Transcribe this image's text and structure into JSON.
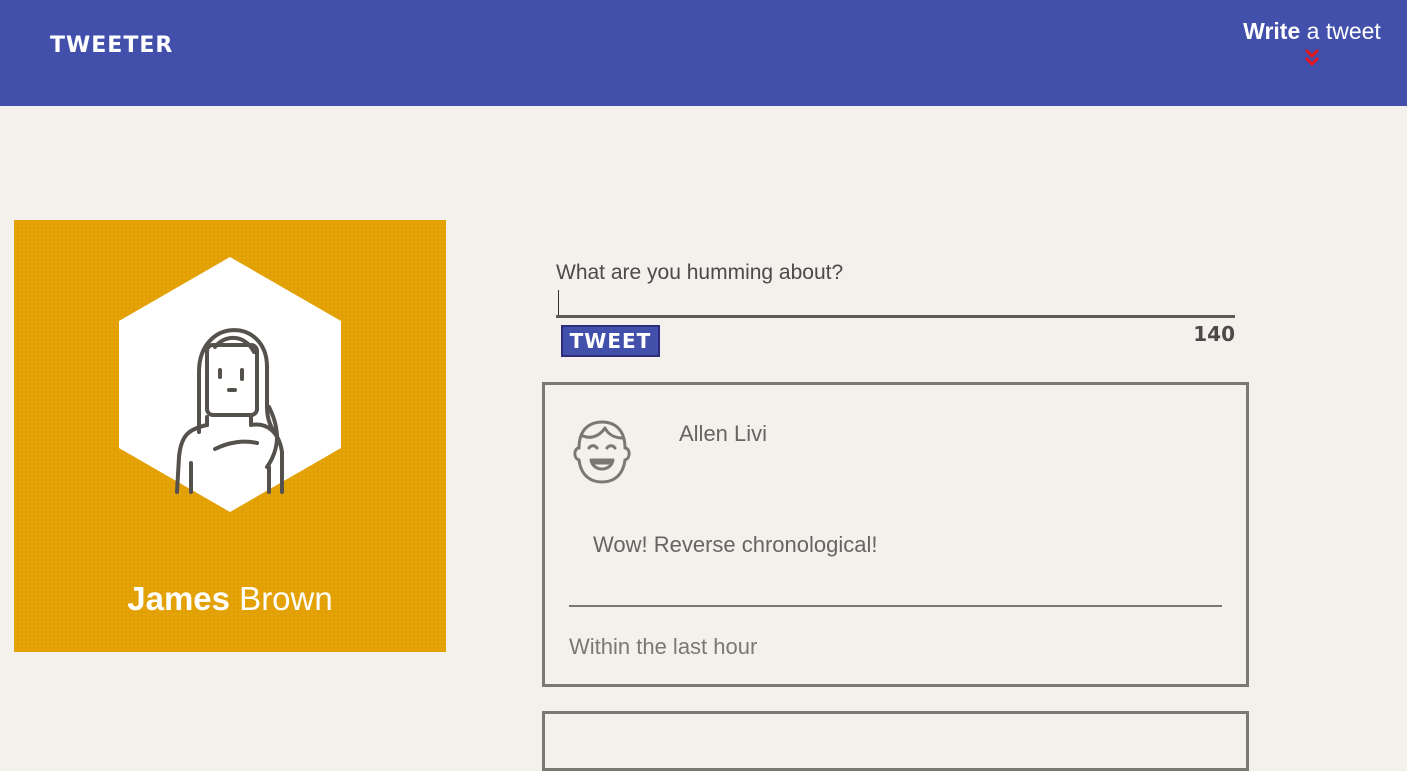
{
  "navbar": {
    "brand": "TWEETER",
    "compose": {
      "strong": "Write",
      "light": " a tweet",
      "arrow_icon": "double-chevron-down-icon",
      "arrow_color": "#e1151c"
    },
    "color": "#4350ab"
  },
  "profile": {
    "first_name": "James",
    "last_name": " Brown",
    "avatar_icon": "woman-avatar-icon",
    "card_color": "#e2a002"
  },
  "composer": {
    "label": "What are you humming about?",
    "value": "",
    "button_label": "TWEET",
    "counter": "140"
  },
  "tweets": [
    {
      "author": "Allen Livi",
      "avatar_icon": "smiling-boy-avatar-icon",
      "text": "Wow! Reverse chronological!",
      "time": "Within the last hour"
    }
  ]
}
